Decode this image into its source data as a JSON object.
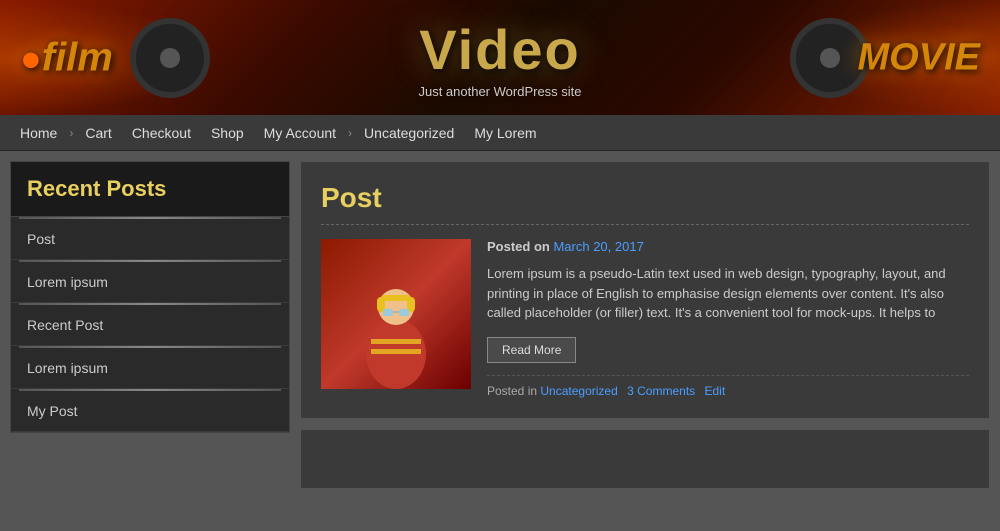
{
  "site": {
    "title": "Video",
    "subtitle": "Just another WordPress site",
    "film_text": "film",
    "movie_text": "MOVIE"
  },
  "nav": {
    "items": [
      {
        "label": "Home",
        "separator": false
      },
      {
        "label": "›",
        "separator": true
      },
      {
        "label": "Cart",
        "separator": false
      },
      {
        "label": "Checkout",
        "separator": false
      },
      {
        "label": "Shop",
        "separator": false
      },
      {
        "label": "My Account",
        "separator": false
      },
      {
        "label": "›",
        "separator": true
      },
      {
        "label": "Uncategorized",
        "separator": false
      },
      {
        "label": "My Lorem",
        "separator": false
      }
    ]
  },
  "sidebar": {
    "recent_posts_title": "Recent Posts",
    "posts": [
      {
        "label": "Post"
      },
      {
        "label": "Lorem ipsum"
      },
      {
        "label": "Recent Post"
      },
      {
        "label": "Lorem ipsum"
      },
      {
        "label": "My Post"
      }
    ]
  },
  "main": {
    "post": {
      "title": "Post",
      "posted_on_label": "Posted on",
      "posted_date": "March 20, 2017",
      "excerpt": "Lorem ipsum is a pseudo-Latin text used in web design, typography, layout, and printing in place of English to emphasise design elements over content. It's also called placeholder (or filler) text. It's a convenient tool for mock-ups. It helps to",
      "read_more_label": "Read More",
      "posted_in_label": "Posted in",
      "category": "Uncategorized",
      "comments": "3 Comments",
      "edit": "Edit"
    }
  }
}
